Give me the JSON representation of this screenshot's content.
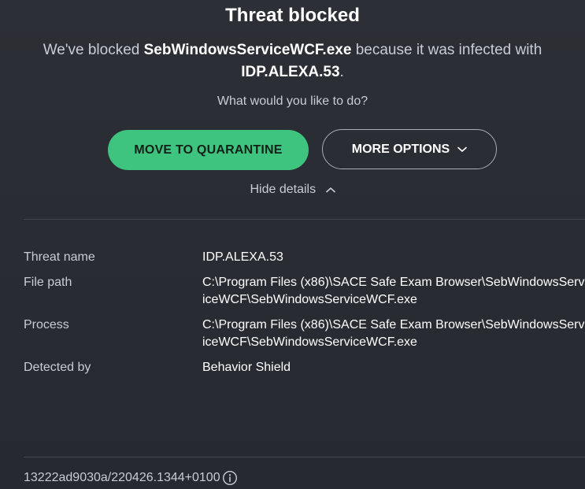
{
  "dialog": {
    "title": "Threat blocked",
    "message_prefix": "We've blocked ",
    "file_name": "SebWindowsServiceWCF.exe",
    "message_middle": " because it was infected with ",
    "threat_name": "IDP.ALEXA.53",
    "message_suffix": ".",
    "prompt": "What would you like to do?",
    "quarantine_label": "MOVE TO QUARANTINE",
    "more_options_label": "MORE OPTIONS",
    "hide_details_label": "Hide details"
  },
  "details": {
    "rows": [
      {
        "label": "Threat name",
        "value": "IDP.ALEXA.53"
      },
      {
        "label": "File path",
        "value": "C:\\Program Files (x86)\\SACE Safe Exam Browser\\SebWindowsServiceWCF\\SebWindowsServiceWCF.exe"
      },
      {
        "label": "Process",
        "value": "C:\\Program Files (x86)\\SACE Safe Exam Browser\\SebWindowsServiceWCF\\SebWindowsServiceWCF.exe"
      },
      {
        "label": "Detected by",
        "value": "Behavior Shield"
      }
    ]
  },
  "footer": {
    "build_id": "13222ad9030a/220426.1344+0100"
  },
  "colors": {
    "background": "#2a2d33",
    "accent_green": "#3fc47f",
    "text_primary": "#ffffff",
    "text_secondary": "#c9ccd2"
  },
  "icons": {
    "more_options": "chevron-down-icon",
    "hide_details": "chevron-up-icon",
    "footer": "info-icon"
  }
}
